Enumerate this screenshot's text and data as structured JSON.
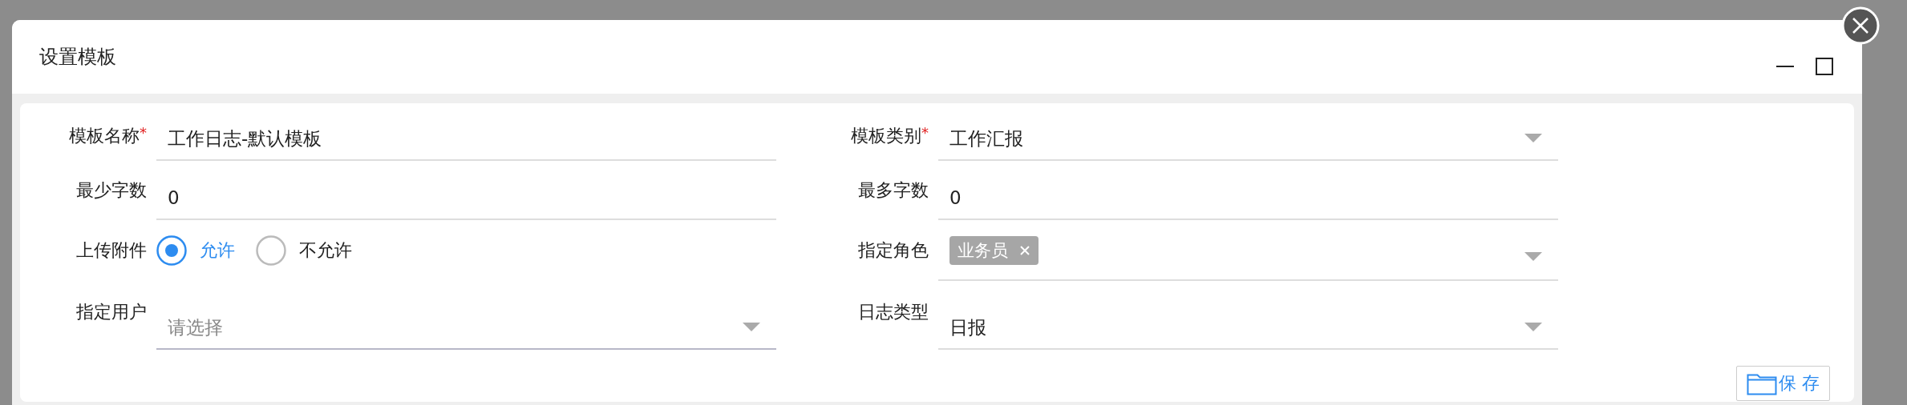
{
  "dialog": {
    "title": "设置模板",
    "save_button": "保 存"
  },
  "rows": [
    {
      "left": {
        "label": "模板名称",
        "required_mark": "*",
        "kind": "text",
        "value": "工作日志-默认模板"
      },
      "right": {
        "label": "模板类别",
        "required_mark": "*",
        "kind": "select",
        "value": "工作汇报"
      }
    },
    {
      "left": {
        "label": "最少字数",
        "kind": "text",
        "value": "0"
      },
      "right": {
        "label": "最多字数",
        "kind": "text",
        "value": "0"
      }
    },
    {
      "left": {
        "label": "上传附件",
        "kind": "radio",
        "options": [
          {
            "label": "允许",
            "selected": true
          },
          {
            "label": "不允许",
            "selected": false
          }
        ]
      },
      "right": {
        "label": "指定角色",
        "kind": "tags",
        "tags": [
          "业务员"
        ]
      }
    },
    {
      "left": {
        "label": "指定用户",
        "kind": "select",
        "placeholder": "请选择"
      },
      "right": {
        "label": "日志类型",
        "kind": "select",
        "value": "日报"
      }
    }
  ]
}
